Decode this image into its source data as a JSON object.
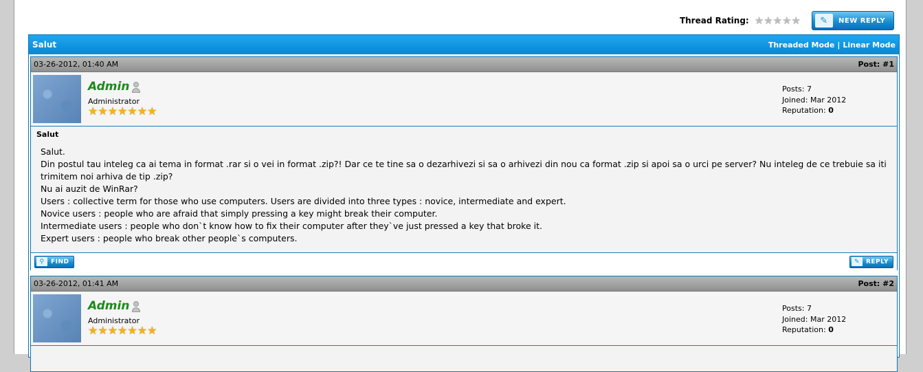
{
  "rating": {
    "label": "Thread Rating:",
    "stars_filled": 0,
    "stars_total": 5
  },
  "toolbar": {
    "new_reply_label": "NEW REPLY"
  },
  "thread": {
    "title": "Salut",
    "threaded_mode": "Threaded Mode",
    "separator": "|",
    "linear_mode": "Linear Mode"
  },
  "posts": [
    {
      "date": "03-26-2012, 01:40 AM",
      "number": "Post: #1",
      "username": "Admin",
      "role": "Administrator",
      "user_stars": 7,
      "posts_label": "Posts:",
      "posts_value": "7",
      "joined_label": "Joined:",
      "joined_value": "Mar 2012",
      "reputation_label": "Reputation:",
      "reputation_value": "0",
      "subject": "Salut",
      "message": [
        "Salut.",
        "Din postul tau inteleg ca ai tema in format .rar si o vei in format .zip?! Dar ce te tine sa o dezarhivezi si sa o arhivezi din nou ca format .zip si apoi sa o urci pe server? Nu inteleg de ce trebuie sa iti trimitem noi arhiva de tip .zip?",
        "Nu ai auzit de WinRar?",
        "Users : collective term for those who use computers. Users are divided into three types : novice, intermediate and expert.",
        "Novice users : people who are afraid that simply pressing a key might break their computer.",
        "Intermediate users : people who don`t know how to fix their computer after they`ve just pressed a key that broke it.",
        "Expert users : people who break other people`s computers."
      ],
      "find_label": "FIND",
      "reply_label": "REPLY"
    },
    {
      "date": "03-26-2012, 01:41 AM",
      "number": "Post: #2",
      "username": "Admin",
      "role": "Administrator",
      "user_stars": 7,
      "posts_label": "Posts:",
      "posts_value": "7",
      "joined_label": "Joined:",
      "joined_value": "Mar 2012",
      "reputation_label": "Reputation:",
      "reputation_value": "0"
    }
  ],
  "colors": {
    "header_blue": "#0688d6",
    "username_green": "#1a8a1a",
    "star_gold": "#f2b21c"
  }
}
